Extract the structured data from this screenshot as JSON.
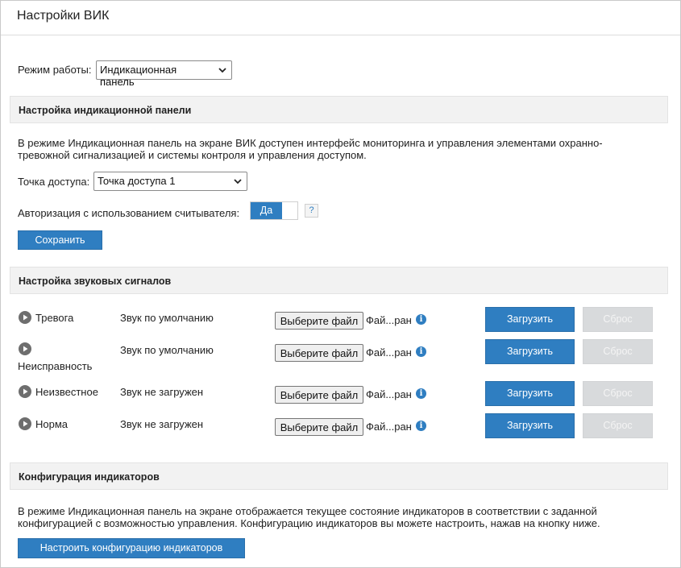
{
  "title": "Настройки ВИК",
  "mode": {
    "label": "Режим работы:",
    "selected": "Индикационная панель"
  },
  "panel_section": {
    "heading": "Настройка индикационной панели",
    "desc_line1": "В режиме Индикационная панель на экране ВИК доступен интерфейс мониторинга и управления элементами охранно-",
    "desc_line2": "тревожной сигнализацией и системы контроля и управления доступом.",
    "access_point_label": "Точка доступа:",
    "access_point_selected": "Точка доступа 1",
    "auth_label": "Авторизация с использованием считывателя:",
    "auth_toggle": "Да",
    "help": "?",
    "save_button": "Сохранить"
  },
  "sound_section": {
    "heading": "Настройка звуковых сигналов",
    "choose_file": "Выберите файл",
    "file_status": "Фай...ран",
    "upload_button": "Загрузить",
    "reset_button": "Сброс",
    "rows": [
      {
        "name": "Тревога",
        "status": "Звук по умолчанию"
      },
      {
        "name": "Неисправность",
        "status": "Звук по умолчанию"
      },
      {
        "name": "Неизвестное",
        "status": "Звук не загружен"
      },
      {
        "name": "Норма",
        "status": "Звук не загружен"
      }
    ]
  },
  "indicators_section": {
    "heading": "Конфигурация индикаторов",
    "desc_line1": "В режиме Индикационная панель на экране отображается текущее состояние индикаторов в соответствии с заданной",
    "desc_line2": "конфигурацией с возможностью управления. Конфигурацию индикаторов вы можете настроить, нажав на кнопку ниже.",
    "configure_button": "Настроить конфигурацию индикаторов"
  },
  "colors": {
    "accent": "#2f7ec1",
    "disabled": "#d8dadc",
    "section_bg": "#f2f2f2"
  },
  "icons": {
    "play": "play-circle-icon",
    "info": "info-icon",
    "chevron": "chevron-down-icon"
  }
}
